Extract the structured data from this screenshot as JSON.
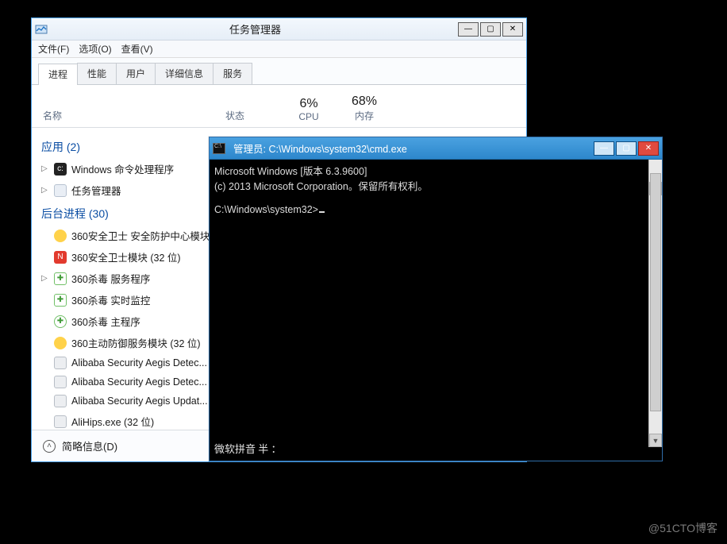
{
  "task_manager": {
    "title": "任务管理器",
    "menu": {
      "file": "文件(F)",
      "options": "选项(O)",
      "view": "查看(V)"
    },
    "tabs": [
      "进程",
      "性能",
      "用户",
      "详细信息",
      "服务"
    ],
    "columns": {
      "name": "名称",
      "status": "状态",
      "cpu_label": "CPU",
      "cpu_value": "6%",
      "mem_label": "内存",
      "mem_value": "68%"
    },
    "groups": [
      {
        "title": "应用 (2)",
        "items": [
          {
            "caret": "▷",
            "icon": "ic-cmd",
            "label": "Windows 命令处理程序"
          },
          {
            "caret": "▷",
            "icon": "ic-tm",
            "label": "任务管理器"
          }
        ]
      },
      {
        "title": "后台进程 (30)",
        "items": [
          {
            "caret": "",
            "icon": "ic-360y",
            "label": "360安全卫士 安全防护中心模块..."
          },
          {
            "caret": "",
            "icon": "ic-360r",
            "label": "360安全卫士模块 (32 位)"
          },
          {
            "caret": "▷",
            "icon": "ic-360g",
            "label": "360杀毒 服务程序"
          },
          {
            "caret": "",
            "icon": "ic-360g",
            "label": "360杀毒 实时监控"
          },
          {
            "caret": "",
            "icon": "ic-360s",
            "label": "360杀毒 主程序"
          },
          {
            "caret": "",
            "icon": "ic-360y",
            "label": "360主动防御服务模块 (32 位)"
          },
          {
            "caret": "",
            "icon": "ic-ali",
            "label": "Alibaba Security Aegis Detec..."
          },
          {
            "caret": "",
            "icon": "ic-ali",
            "label": "Alibaba Security Aegis Detec..."
          },
          {
            "caret": "",
            "icon": "ic-ali",
            "label": "Alibaba Security Aegis Updat..."
          },
          {
            "caret": "",
            "icon": "ic-ali",
            "label": "AliHips.exe (32 位)"
          }
        ]
      }
    ],
    "brief_info": "简略信息(D)"
  },
  "cmd": {
    "title": "管理员: C:\\Windows\\system32\\cmd.exe",
    "line1": "Microsoft Windows [版本 6.3.9600]",
    "line2": "(c) 2013 Microsoft Corporation。保留所有权利。",
    "prompt": "C:\\Windows\\system32>",
    "ime": "微软拼音 半 ："
  },
  "watermark": "@51CTO博客"
}
